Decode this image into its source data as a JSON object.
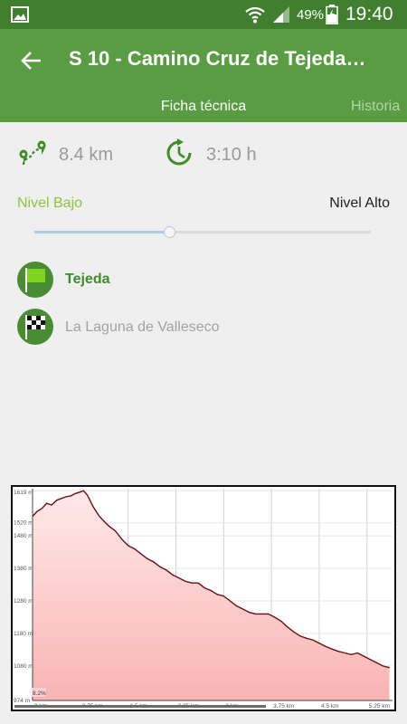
{
  "status_bar": {
    "battery_percent": "49%",
    "time": "19:40"
  },
  "app_bar": {
    "title": "S 10 - Camino Cruz de Tejeda…"
  },
  "tabs": [
    {
      "label": "Ficha técnica",
      "selected": true
    },
    {
      "label": "Historia",
      "selected": false
    }
  ],
  "stats": {
    "distance": "8.4 km",
    "duration": "3:10 h"
  },
  "difficulty": {
    "low_label": "Nivel Bajo",
    "high_label": "Nivel Alto",
    "level_fraction": 0.4
  },
  "route": {
    "start": "Tejeda",
    "end": "La Laguna de Valleseco"
  },
  "colors": {
    "primary": "#5a9c43",
    "status_bar": "#3f7f2f",
    "accent_low": "#8bc53f",
    "profile_line": "#6b0f0f",
    "profile_fill": "#f9b3b3"
  },
  "chart_data": {
    "type": "area",
    "xlabel": "",
    "ylabel": "",
    "y_ticks": [
      "1619 m",
      "1520 m",
      "1480 m",
      "1380 m",
      "1280 m",
      "1180 m",
      "1080 m",
      "974 m"
    ],
    "y_tick_values": [
      1619,
      1520,
      1480,
      1380,
      1280,
      1180,
      1080,
      974
    ],
    "x_ticks": [
      "0 km",
      "0.75 km",
      "1.5 km",
      "2.25 km",
      "3 km",
      "3.75 km",
      "4.5 km",
      "5.25 km"
    ],
    "x_tick_values": [
      0,
      0.75,
      1.5,
      2.25,
      3,
      3.75,
      4.5,
      5.25
    ],
    "x_range": [
      0,
      5.65
    ],
    "y_range": [
      974,
      1625
    ],
    "annotations": [
      "8.2%"
    ],
    "x": [
      0,
      0.07,
      0.15,
      0.22,
      0.3,
      0.38,
      0.45,
      0.52,
      0.6,
      0.67,
      0.75,
      0.8,
      0.86,
      0.9,
      0.95,
      1.0,
      1.05,
      1.12,
      1.2,
      1.3,
      1.4,
      1.5,
      1.6,
      1.7,
      1.8,
      1.9,
      2.0,
      2.1,
      2.2,
      2.3,
      2.4,
      2.5,
      2.6,
      2.7,
      2.8,
      2.9,
      3.0,
      3.1,
      3.2,
      3.3,
      3.4,
      3.5,
      3.6,
      3.7,
      3.8,
      3.9,
      4.0,
      4.1,
      4.2,
      4.3,
      4.4,
      4.5,
      4.6,
      4.7,
      4.8,
      4.9,
      5.0,
      5.1,
      5.2,
      5.3,
      5.4,
      5.5,
      5.6
    ],
    "y": [
      1540,
      1555,
      1565,
      1580,
      1575,
      1590,
      1595,
      1600,
      1603,
      1610,
      1615,
      1619,
      1605,
      1590,
      1570,
      1555,
      1540,
      1525,
      1510,
      1495,
      1470,
      1450,
      1440,
      1425,
      1410,
      1400,
      1385,
      1375,
      1360,
      1350,
      1340,
      1335,
      1335,
      1320,
      1312,
      1300,
      1295,
      1280,
      1265,
      1255,
      1245,
      1240,
      1240,
      1240,
      1230,
      1218,
      1200,
      1185,
      1172,
      1165,
      1160,
      1150,
      1140,
      1132,
      1125,
      1120,
      1115,
      1120,
      1110,
      1100,
      1090,
      1080,
      1075
    ]
  }
}
